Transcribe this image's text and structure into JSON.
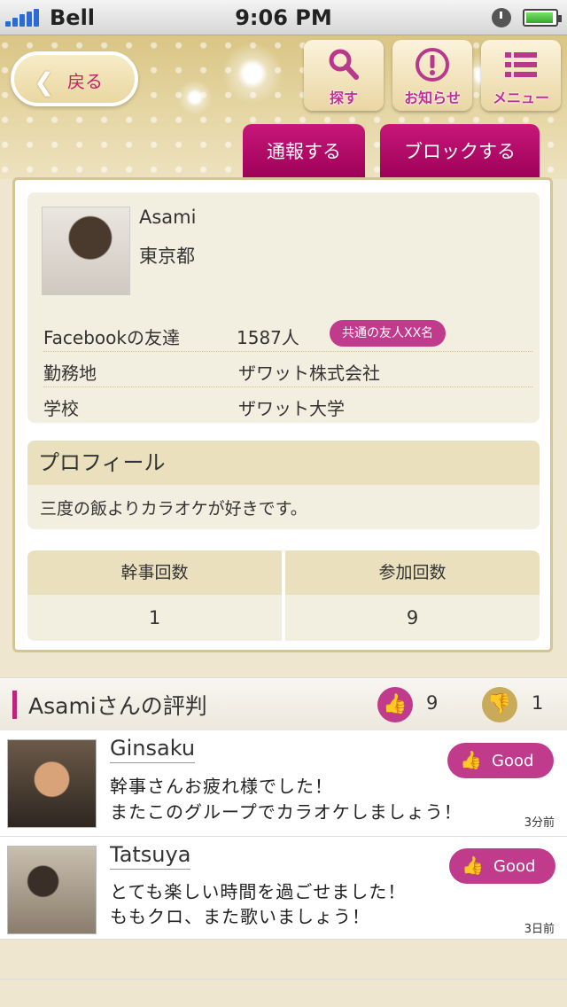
{
  "status_bar": {
    "carrier": "Bell",
    "time": "9:06 PM"
  },
  "header": {
    "back_label": "戻る",
    "search_label": "探す",
    "notice_label": "お知らせ",
    "menu_label": "メニュー",
    "tab_report": "通報する",
    "tab_block": "ブロックする"
  },
  "profile": {
    "name": "Asami",
    "location": "東京都",
    "rows": [
      {
        "key": "Facebookの友達",
        "value": "1587人",
        "badge": "共通の友人XX名"
      },
      {
        "key": "勤務地",
        "value": "ザワット株式会社"
      },
      {
        "key": "学校",
        "value": "ザワット大学"
      }
    ],
    "profile_heading": "プロフィール",
    "profile_text": "三度の飯よりカラオケが好きです。",
    "stats": [
      {
        "label": "幹事回数",
        "value": "1"
      },
      {
        "label": "参加回数",
        "value": "9"
      }
    ]
  },
  "reputation": {
    "title": "Asamiさんの評判",
    "good_count": "9",
    "bad_count": "1",
    "reviews": [
      {
        "name": "Ginsaku",
        "badge": "Good",
        "line1": "幹事さんお疲れ様でした！",
        "line2": "またこのグループでカラオケしましょう！",
        "time": "3分前"
      },
      {
        "name": "Tatsuya",
        "badge": "Good",
        "line1": "とても楽しい時間を過ごせました！",
        "line2": "ももクロ、また歌いましょう！",
        "time": "3日前"
      }
    ]
  },
  "colors": {
    "accent": "#c13b8c",
    "tab": "#b00068",
    "header_gold": "#ddc98a",
    "panel": "#f3efe0"
  }
}
